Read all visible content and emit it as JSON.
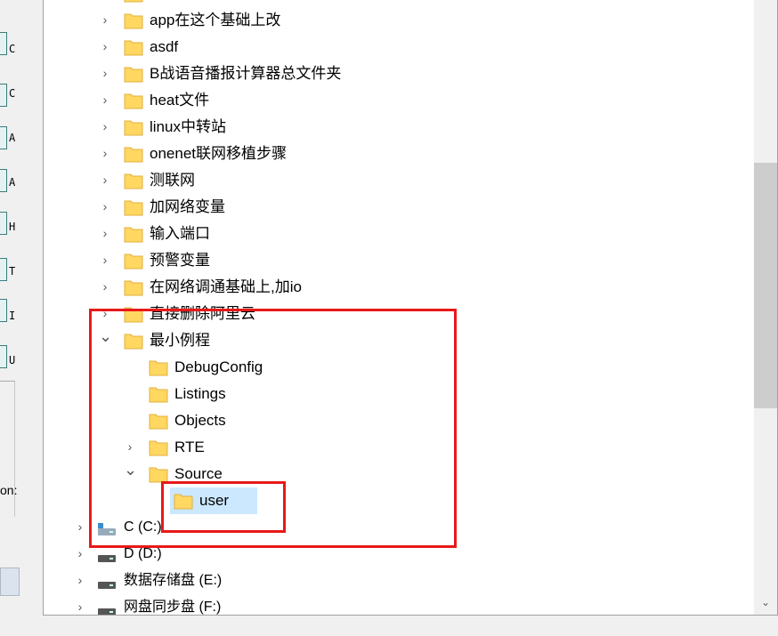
{
  "left_strip": {
    "letters": [
      "C",
      "C",
      "A",
      "A",
      "H",
      "T",
      "I",
      "U"
    ],
    "label": "on:"
  },
  "tree": {
    "items": [
      {
        "label": "app在这个基础上改",
        "expanded": false
      },
      {
        "label": "asdf",
        "expanded": false
      },
      {
        "label": "B战语音播报计算器总文件夹",
        "expanded": false
      },
      {
        "label": "heat文件",
        "expanded": false
      },
      {
        "label": "linux中转站",
        "expanded": false
      },
      {
        "label": "onenet联网移植步骤",
        "expanded": false
      },
      {
        "label": "测联网",
        "expanded": false
      },
      {
        "label": "加网络变量",
        "expanded": false
      },
      {
        "label": "输入端口",
        "expanded": false
      },
      {
        "label": "预警变量",
        "expanded": false
      },
      {
        "label": "在网络调通基础上,加io",
        "expanded": false
      },
      {
        "label": "直接删除阿里云",
        "expanded": false
      },
      {
        "label": "最小例程",
        "expanded": true
      },
      {
        "label": "DebugConfig"
      },
      {
        "label": "Listings"
      },
      {
        "label": "Objects"
      },
      {
        "label": "RTE",
        "expanded": false
      },
      {
        "label": "Source",
        "expanded": true
      },
      {
        "label": "user",
        "selected": true
      }
    ],
    "drives": [
      {
        "label": "C (C:)"
      },
      {
        "label": "D (D:)"
      },
      {
        "label": "数据存储盘 (E:)"
      },
      {
        "label": "网盘同步盘 (F:)"
      }
    ]
  },
  "colors": {
    "highlight_red": "#e8191a",
    "selection_blue": "#cce8ff",
    "folder_yellow": "#ffd761"
  },
  "icons": {
    "collapsed": "chevron-right-icon",
    "expanded": "chevron-down-icon",
    "folder": "folder-icon",
    "drive": "drive-icon",
    "scroll_down": "scroll-down-arrow-icon"
  }
}
